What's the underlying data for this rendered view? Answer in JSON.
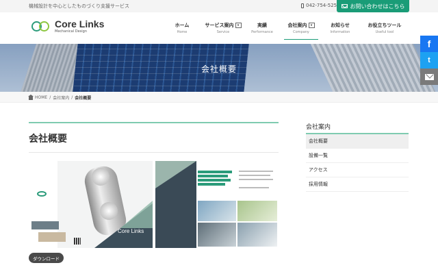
{
  "topbar": {
    "tagline": "機械設計を中心としたものづくり支援サービス",
    "phone": "042-754-5255",
    "contact_label": "お問い合わせはこちら"
  },
  "logo": {
    "name": "Core Links",
    "sub": "Mechanical Design"
  },
  "nav": [
    {
      "jp": "ホーム",
      "en": "Home",
      "dropdown": false
    },
    {
      "jp": "サービス案内",
      "en": "Service",
      "dropdown": true
    },
    {
      "jp": "実績",
      "en": "Performance",
      "dropdown": false
    },
    {
      "jp": "会社案内",
      "en": "Company",
      "dropdown": true,
      "active": true
    },
    {
      "jp": "お知らせ",
      "en": "Information",
      "dropdown": false
    },
    {
      "jp": "お役立ちツール",
      "en": "Useful tool",
      "dropdown": false
    }
  ],
  "nav_dropdown_glyph": "∨",
  "hero": {
    "title": "会社概要"
  },
  "breadcrumb": {
    "home": "HOME",
    "parent": "会社案内",
    "sep": "/",
    "current": "会社概要"
  },
  "main": {
    "title": "会社概要",
    "download_label": "ダウンロード",
    "brochure_brand": "Core Links"
  },
  "sidebar": {
    "title": "会社案内",
    "items": [
      "会社概要",
      "設備一覧",
      "アクセス",
      "採用情報"
    ]
  },
  "share": {
    "facebook": "f",
    "twitter": "t"
  },
  "colors": {
    "accent": "#1a9c77",
    "accent_light": "#7fcbb0",
    "facebook": "#1877f2",
    "twitter": "#1da1f2"
  }
}
